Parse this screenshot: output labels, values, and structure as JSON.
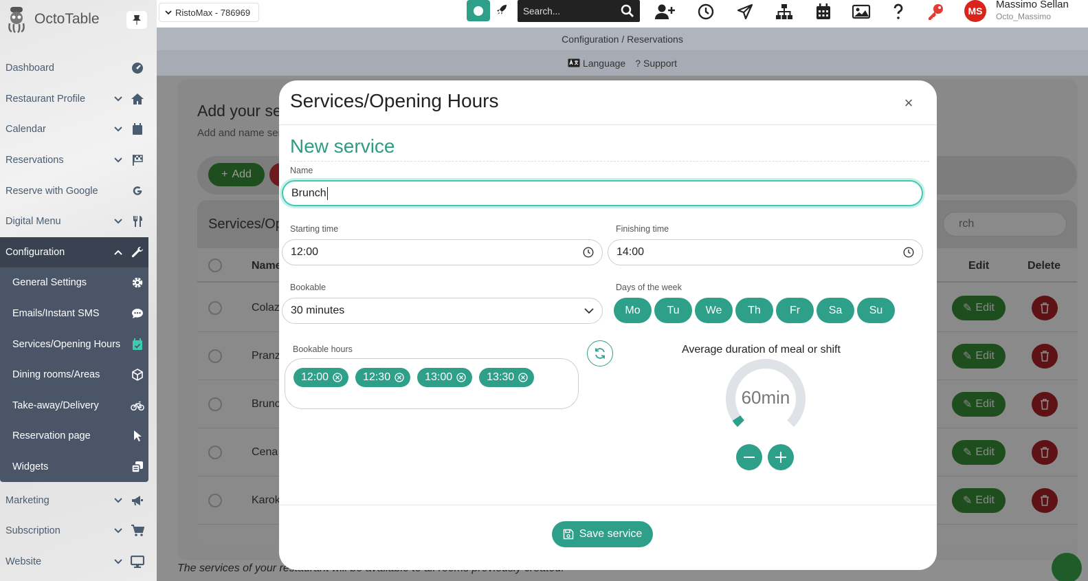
{
  "app": {
    "name": "OctoTable"
  },
  "restaurant_select": {
    "value": "RistoMax - 786969"
  },
  "search": {
    "placeholder": "Search..."
  },
  "user": {
    "initials": "MS",
    "name": "Massimo Sellan",
    "username": "Octo_Massimo"
  },
  "breadcrumb": "Configuration / Reservations",
  "links": {
    "language": "Language",
    "support": "Support"
  },
  "sidebar": {
    "items": [
      {
        "label": "Dashboard"
      },
      {
        "label": "Restaurant Profile"
      },
      {
        "label": "Calendar"
      },
      {
        "label": "Reservations"
      },
      {
        "label": "Reserve with Google"
      },
      {
        "label": "Digital Menu"
      },
      {
        "label": "Configuration"
      },
      {
        "label": "Marketing"
      },
      {
        "label": "Subscription"
      },
      {
        "label": "Website"
      }
    ],
    "sub_items": [
      {
        "label": "General Settings"
      },
      {
        "label": "Emails/Instant SMS"
      },
      {
        "label": "Services/Opening Hours"
      },
      {
        "label": "Dining rooms/Areas"
      },
      {
        "label": "Take-away/Delivery"
      },
      {
        "label": "Reservation page"
      },
      {
        "label": "Widgets"
      }
    ]
  },
  "background": {
    "title": "Add your ser",
    "subtitle": "Add and name serv",
    "add_label": "Add",
    "table_title": "Services/Open",
    "search_placeholder": "rch",
    "col_name": "Name",
    "col_edit": "Edit",
    "col_delete": "Delete",
    "rows": [
      {
        "name": "Colazion"
      },
      {
        "name": "Pranzo"
      },
      {
        "name": "Brunch"
      },
      {
        "name": "Cena"
      },
      {
        "name": "Karoke N"
      }
    ],
    "edit_label": "Edit",
    "footer": "The services of your restaurant will be available to all rooms previously created."
  },
  "modal": {
    "title": "Services/Opening Hours",
    "close": "×",
    "section_title": "New service",
    "name_label": "Name",
    "name_value": "Brunch",
    "start_label": "Starting time",
    "start_value": "12:00",
    "end_label": "Finishing time",
    "end_value": "14:00",
    "bookable_label": "Bookable",
    "bookable_value": "30 minutes",
    "days_label": "Days of the week",
    "days": [
      "Mo",
      "Tu",
      "We",
      "Th",
      "Fr",
      "Sa",
      "Su"
    ],
    "hours_label": "Bookable hours",
    "hours": [
      "12:00",
      "12:30",
      "13:00",
      "13:30"
    ],
    "avg_title": "Average duration of meal or shift",
    "avg_value": "60min",
    "avg_fraction": 0.17,
    "save_label": "Save service"
  },
  "colors": {
    "accent": "#2ea08a",
    "danger": "#d9241c",
    "sidebar_active": "#3a4252"
  }
}
